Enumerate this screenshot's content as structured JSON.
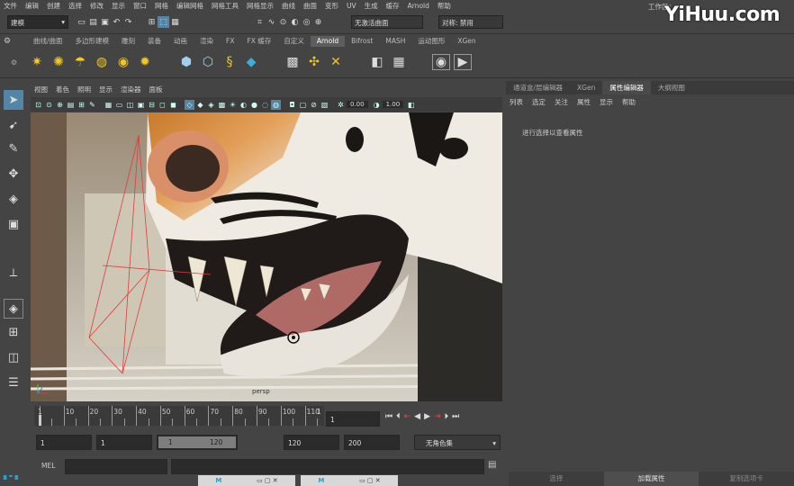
{
  "menubar": {
    "items": [
      "文件",
      "编辑",
      "创建",
      "选择",
      "修改",
      "显示",
      "窗口",
      "网格",
      "编辑网格",
      "网格工具",
      "网格显示",
      "曲线",
      "曲面",
      "变形",
      "UV",
      "生成",
      "缓存",
      "Arnold",
      "帮助"
    ],
    "workspace_label": "工作区："
  },
  "status": {
    "mode": "建模",
    "live_surface": "无激活曲面",
    "symmetry": "对称: 禁用"
  },
  "shelf_tabs": [
    "曲线/曲面",
    "多边形建模",
    "雕刻",
    "装备",
    "动画",
    "渲染",
    "FX",
    "FX 缓存",
    "自定义",
    "Arnold",
    "Bifrost",
    "MASH",
    "运动图形",
    "XGen"
  ],
  "shelf_active": "Arnold",
  "panel_menu": [
    "视图",
    "着色",
    "照明",
    "显示",
    "渲染器",
    "面板"
  ],
  "panel_toolbar": {
    "value1": "0.00",
    "value2": "1.00"
  },
  "viewport": {
    "camera_label": "persp"
  },
  "right_tabs": [
    "通道盒/层编辑器",
    "XGen",
    "属性编辑器",
    "大纲视图"
  ],
  "right_tab_active": "属性编辑器",
  "right_menu": [
    "列表",
    "选定",
    "关注",
    "属性",
    "显示",
    "帮助"
  ],
  "right_message": "进行选择以查看属性",
  "timeline": {
    "ticks": [
      "1",
      "10",
      "20",
      "30",
      "40",
      "50",
      "60",
      "70",
      "80",
      "90",
      "100",
      "110",
      "1"
    ],
    "current_frame": "1"
  },
  "range": {
    "start": "1",
    "range_start": "1",
    "slider_start": "1",
    "slider_end": "120",
    "range_end": "120",
    "end": "200",
    "character_set": "无角色集"
  },
  "cmd": {
    "label": "MEL"
  },
  "bottom_tabs": [
    "选择",
    "加载属性",
    "复制选项卡"
  ],
  "bottom_tab_active": "加载属性",
  "watermark": "YiHuu.com",
  "colors": {
    "accent": "#5285a6",
    "active_tab": "#5d5d5d",
    "keyframe_red": "#e04040"
  }
}
